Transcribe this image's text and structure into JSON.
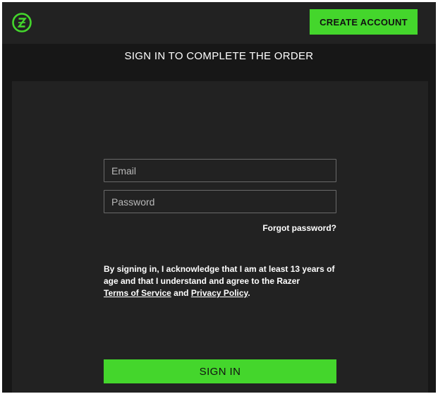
{
  "header": {
    "logo_icon": "razer-zsilver-logo-icon",
    "create_account_label": "CREATE ACCOUNT"
  },
  "main": {
    "title": "SIGN IN TO COMPLETE THE ORDER"
  },
  "form": {
    "email_placeholder": "Email",
    "email_value": "",
    "password_placeholder": "Password",
    "password_value": "",
    "forgot_password_label": "Forgot password?",
    "disclaimer_text": "By signing in, I acknowledge that I am at least 13 years of age and that I understand and agree to the Razer",
    "terms_label": "Terms of Service",
    "and_text": " and ",
    "privacy_label": "Privacy Policy",
    "period_text": ".",
    "sign_in_label": "SIGN IN"
  },
  "colors": {
    "accent": "#44d62c",
    "background": "#171717",
    "panel": "#222222"
  }
}
